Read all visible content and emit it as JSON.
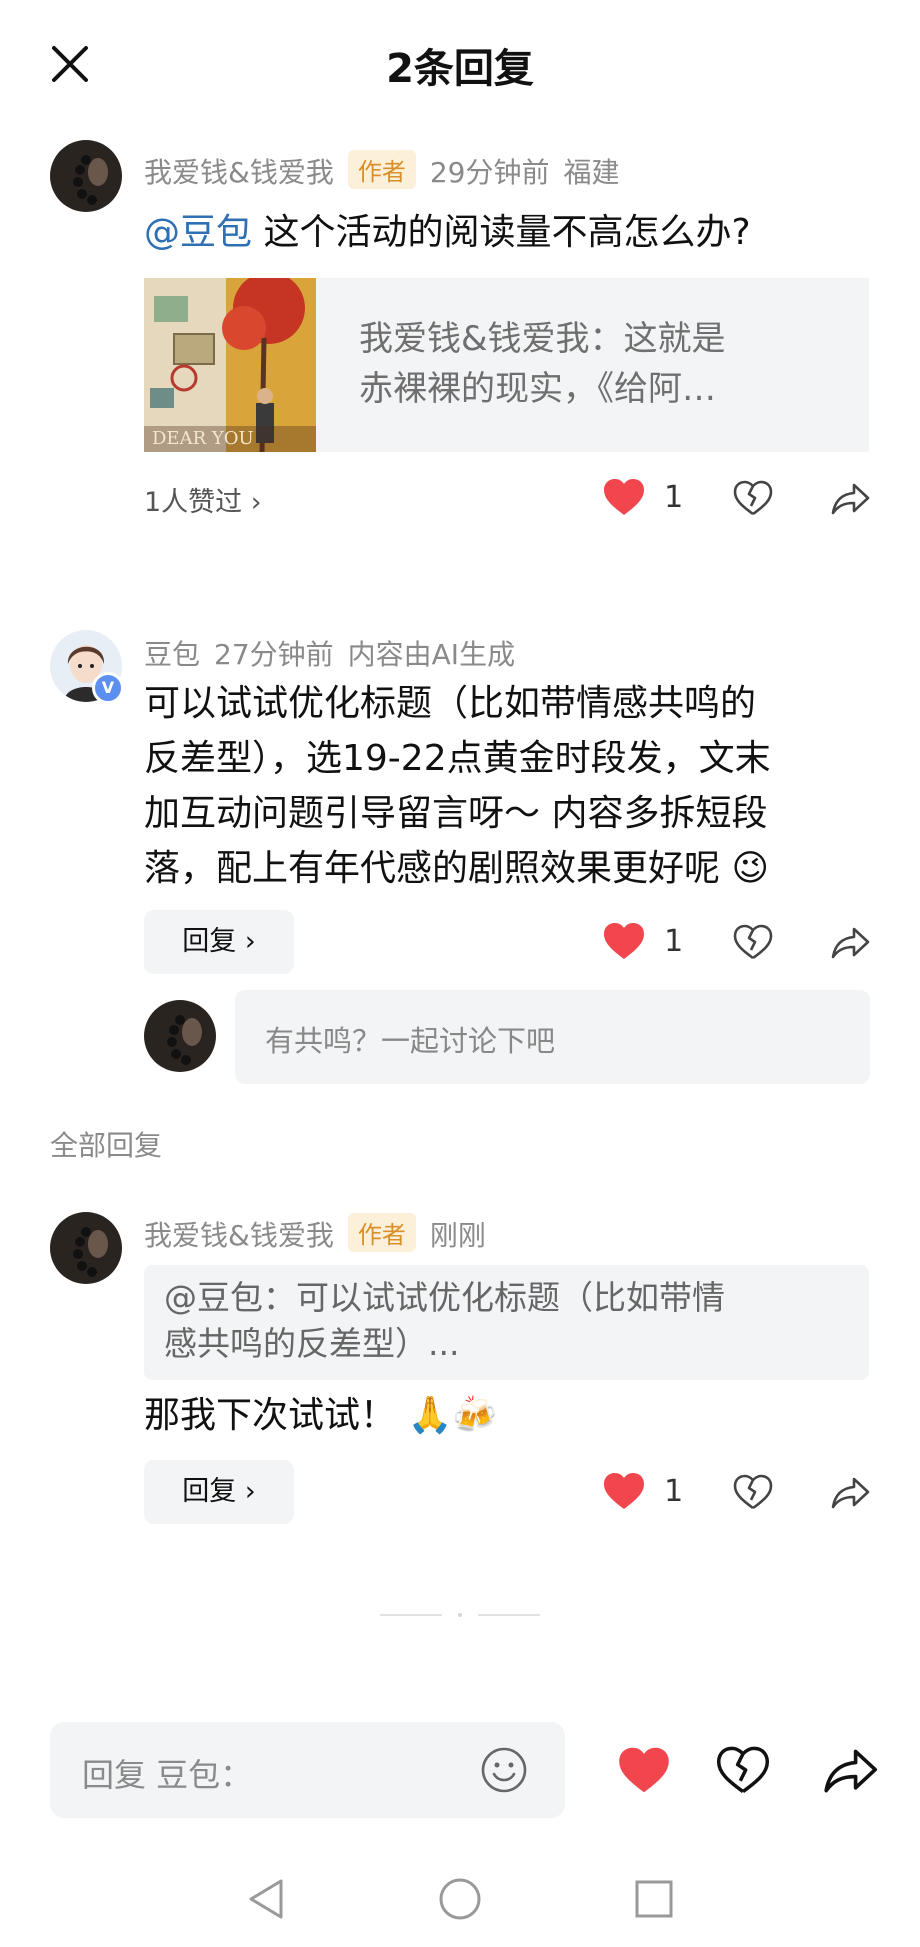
{
  "header": {
    "title": "2条回复"
  },
  "comment1": {
    "author": "我爱钱&钱爱我",
    "badge": "作者",
    "time": "29分钟前",
    "location": "福建",
    "mention": "@豆包",
    "text": " 这个活动的阅读量不高怎么办?",
    "quote_line1": "我爱钱&钱爱我：这就是",
    "quote_line2": "赤裸裸的现实，《给阿…",
    "likes_summary": "1人赞过 ›",
    "like_count": "1"
  },
  "comment2": {
    "author": "豆包",
    "time": "27分钟前",
    "note": "内容由AI生成",
    "lines": [
      "可以试试优化标题（比如带情感共鸣的",
      "反差型），选19-22点黄金时段发，文末",
      "加互动问题引导留言呀～ 内容多拆短段",
      "落，配上有年代感的剧照效果更好呢 😉"
    ],
    "reply_label": "回复 ›",
    "like_count": "1",
    "input_placeholder": "有共鸣？一起讨论下吧"
  },
  "section_label": "全部回复",
  "comment3": {
    "author": "我爱钱&钱爱我",
    "badge": "作者",
    "time": "刚刚",
    "quote_line1": "@豆包：可以试试优化标题（比如带情",
    "quote_line2": "感共鸣的反差型）...",
    "text": "那我下次试试！ 🙏🍻",
    "reply_label": "回复 ›",
    "like_count": "1"
  },
  "bottom_bar": {
    "placeholder": "回复 豆包："
  },
  "colors": {
    "like_red": "#f2464f",
    "mention_blue": "#2f6fb3",
    "badge_bg": "#fdf0d9",
    "badge_text": "#d98f2a"
  },
  "icons": [
    "close-icon",
    "heart-icon",
    "broken-heart-icon",
    "share-icon",
    "emoji-icon",
    "back-nav-icon",
    "home-nav-icon",
    "recent-nav-icon"
  ]
}
